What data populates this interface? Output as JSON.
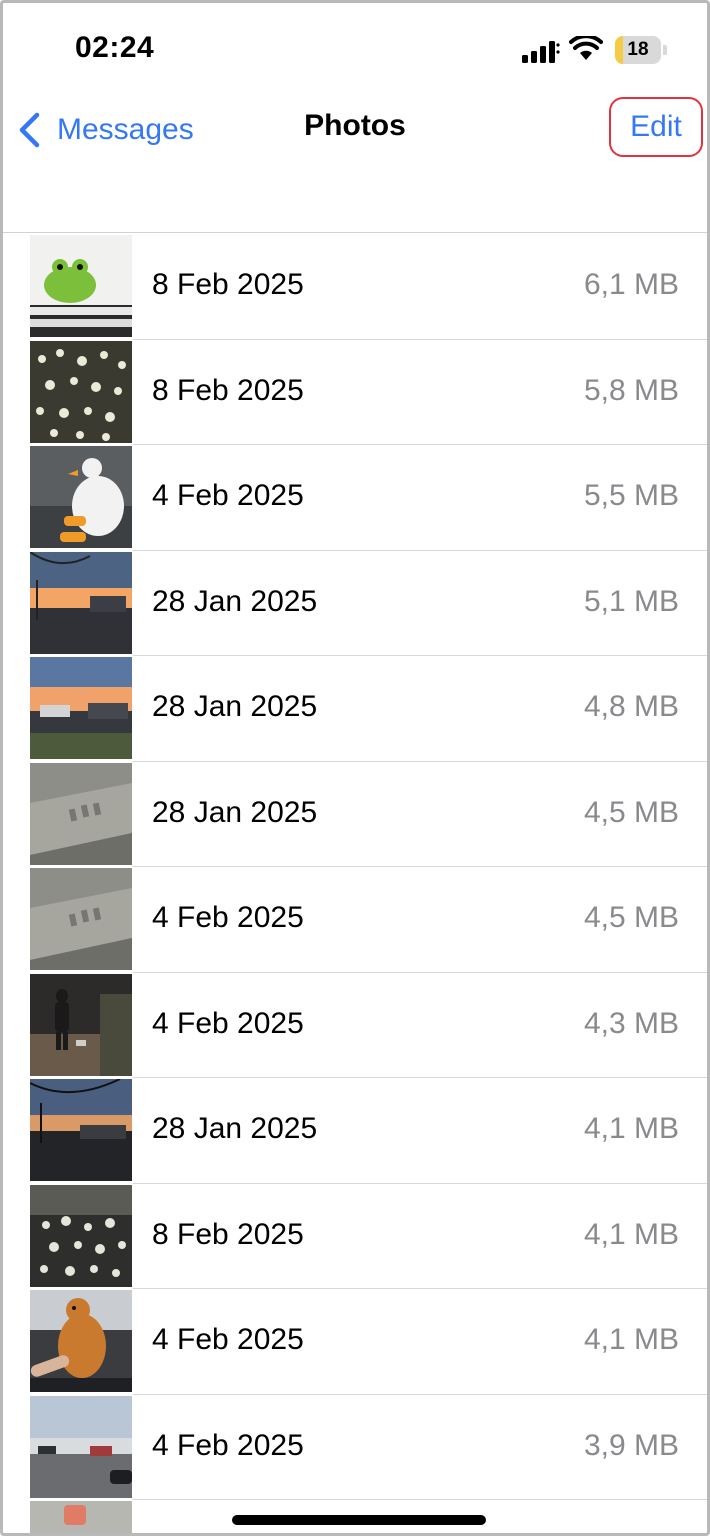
{
  "status_bar": {
    "time": "02:24",
    "battery_level": "18",
    "battery_fraction": 0.18,
    "battery_color": "#f4cc44",
    "signal_icon": "cellular-signal-icon",
    "wifi_icon": "wifi-icon"
  },
  "nav": {
    "back_label": "Messages",
    "back_icon": "chevron-left-icon",
    "title": "Photos",
    "edit_label": "Edit",
    "accent_color": "#3478f6",
    "edit_highlight_color": "#e0353f"
  },
  "photos": [
    {
      "date": "8 Feb 2025",
      "size": "6,1 MB",
      "thumbnail": "frog-drawing"
    },
    {
      "date": "8 Feb 2025",
      "size": "5,8 MB",
      "thumbnail": "glowing-crystals"
    },
    {
      "date": "4 Feb 2025",
      "size": "5,5 MB",
      "thumbnail": "goose-plush"
    },
    {
      "date": "28 Jan 2025",
      "size": "5,1 MB",
      "thumbnail": "sunset-street"
    },
    {
      "date": "28 Jan 2025",
      "size": "4,8 MB",
      "thumbnail": "sunset-parking"
    },
    {
      "date": "28 Jan 2025",
      "size": "4,5 MB",
      "thumbnail": "concrete-texture"
    },
    {
      "date": "4 Feb 2025",
      "size": "4,5 MB",
      "thumbnail": "concrete-texture"
    },
    {
      "date": "4 Feb 2025",
      "size": "4,3 MB",
      "thumbnail": "person-walking-dog"
    },
    {
      "date": "28 Jan 2025",
      "size": "4,1 MB",
      "thumbnail": "dusk-street"
    },
    {
      "date": "8 Feb 2025",
      "size": "4,1 MB",
      "thumbnail": "glowing-crystals-dark"
    },
    {
      "date": "4 Feb 2025",
      "size": "4,1 MB",
      "thumbnail": "capybara-plush"
    },
    {
      "date": "4 Feb 2025",
      "size": "3,9 MB",
      "thumbnail": "parking-lot"
    },
    {
      "date": "",
      "size": "",
      "thumbnail": "partial-photo"
    }
  ]
}
